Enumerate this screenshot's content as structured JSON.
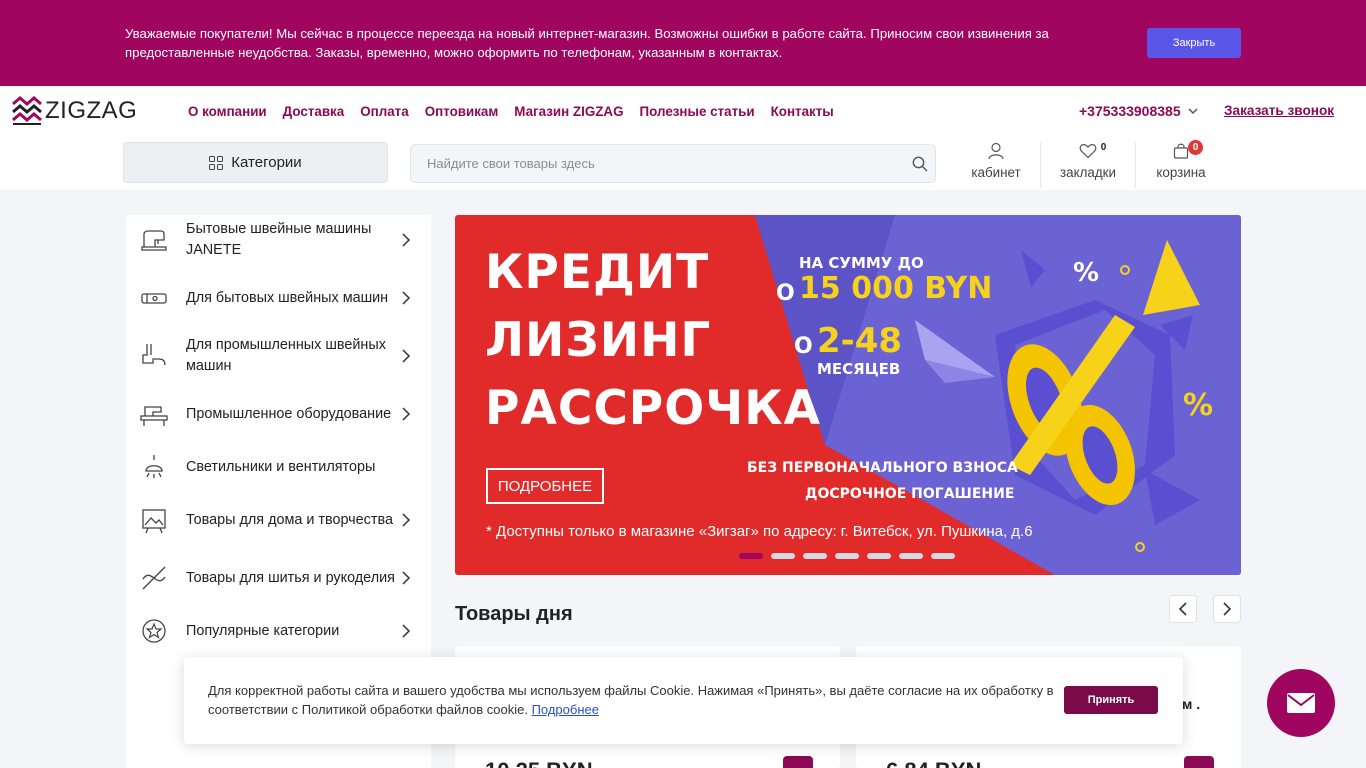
{
  "notice": {
    "text": "Уважаемые покупатели! Мы сейчас в процессе переезда на новый интернет-магазин. Возможны ошибки в работе сайта. Приносим свои извинения за предоставленные неудобства. Заказы, временно, можно оформить по телефонам, указанным в контактах.",
    "close_label": "Закрыть"
  },
  "header": {
    "logo_text": "ZIGZAG",
    "nav": [
      "О компании",
      "Доставка",
      "Оплата",
      "Оптовикам",
      "Магазин ZIGZAG",
      "Полезные статьи",
      "Контакты"
    ],
    "phone": "+375333908385",
    "callback": "Заказать звонок",
    "categories_label": "Категории",
    "search_placeholder": "Найдите свои товары здесь",
    "account_label": "кабинет",
    "bookmarks_label": "закладки",
    "bookmarks_count": "0",
    "cart_label": "корзина",
    "cart_count": "0"
  },
  "sidebar": {
    "items": [
      {
        "label": "Бытовые швейные машины JANETE",
        "icon": "sewing-machine-icon",
        "has_arrow": true
      },
      {
        "label": "Для бытовых швейных машин",
        "icon": "presser-foot-icon",
        "has_arrow": true
      },
      {
        "label": "Для промышленных швейных машин",
        "icon": "industrial-foot-icon",
        "has_arrow": true
      },
      {
        "label": "Промышленное оборудование",
        "icon": "industrial-machine-icon",
        "has_arrow": true
      },
      {
        "label": "Светильники и вентиляторы",
        "icon": "lamp-icon",
        "has_arrow": false
      },
      {
        "label": "Товары для дома и творчества",
        "icon": "picture-icon",
        "has_arrow": true
      },
      {
        "label": "Товары для шитья и рукоделия",
        "icon": "needle-thread-icon",
        "has_arrow": true
      },
      {
        "label": "Популярные категории",
        "icon": "star-icon",
        "has_arrow": true
      }
    ]
  },
  "banner": {
    "line1": "КРЕДИТ",
    "line2": "ЛИЗИНГ",
    "line3": "РАССРОЧКА",
    "sum_caption": "НА СУММУ ДО",
    "sum_prefix": "О",
    "sum_value": "15 000 BYN",
    "term_prefix": "О",
    "term_value": "2-48",
    "term_unit": "МЕСЯЦЕВ",
    "cond1": "БЕЗ ПЕРВОНАЧАЛЬНОГО ВЗНОСА",
    "cond2": "ДОСРОЧНОЕ ПОГАШЕНИЕ",
    "more_label": "ПОДРОБНЕЕ",
    "footnote": "* Доступны только в магазине «Зигзаг» по адресу:  г. Витебск, ул. Пушкина, д.6",
    "slides_count": 7,
    "active_slide": 1,
    "colors": {
      "red": "#e12a2a",
      "purple": "#6b62d4",
      "yellow": "#f7d21b"
    }
  },
  "products": {
    "title": "Товары дня",
    "prices": [
      "10,25 BYN",
      "6,84 BYN"
    ],
    "partial_text": "м ."
  },
  "cookie": {
    "text": "Для корректной работы сайта и вашего удобства мы используем файлы Cookie. Нажимая «Принять», вы даёте согласие на их обработку в соответствии с Политикой обработки файлов cookie.",
    "link": "Подробнее",
    "accept_label": "Принять"
  },
  "colors": {
    "brand": "#a0065f",
    "nav": "#8c0a55",
    "close_button": "#5a57e8",
    "badge": "#e03838"
  }
}
